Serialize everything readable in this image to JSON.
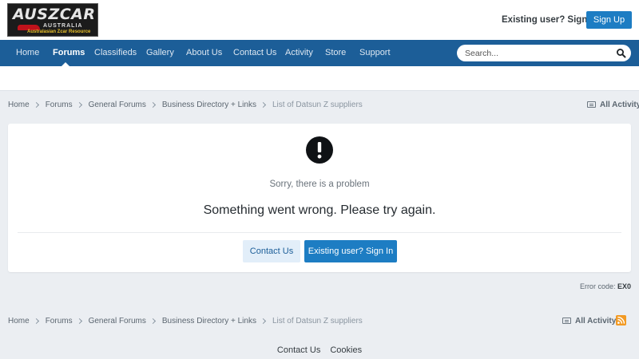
{
  "header": {
    "logo": {
      "line1": "AUSZCAR",
      "line2": "AUSTRALIA",
      "line3": "Australasian Zcar Resource"
    },
    "signin_label": "Existing user? Sign In",
    "signup_label": "Sign Up"
  },
  "nav": {
    "items": [
      "Home",
      "Forums",
      "Classifieds",
      "Gallery",
      "About Us",
      "Contact Us",
      "Activity",
      "Store",
      "Support"
    ],
    "active": "Forums"
  },
  "search": {
    "placeholder": "Search..."
  },
  "breadcrumb": {
    "items": [
      "Home",
      "Forums",
      "General Forums",
      "Business Directory + Links",
      "List of Datsun Z suppliers"
    ]
  },
  "all_activity_label": "All Activity",
  "error_panel": {
    "problem": "Sorry, there is a problem",
    "message": "Something went wrong. Please try again.",
    "contact_label": "Contact Us",
    "signin_label": "Existing user? Sign In"
  },
  "error_code": {
    "label": "Error code:",
    "value": "EX0"
  },
  "footer": {
    "links": [
      "Contact Us",
      "Cookies"
    ]
  },
  "colors": {
    "nav_bg": "#1c5e98",
    "primary_button": "#1d7dc3",
    "page_bg": "#ebeef2",
    "rss": "#f29a24"
  }
}
